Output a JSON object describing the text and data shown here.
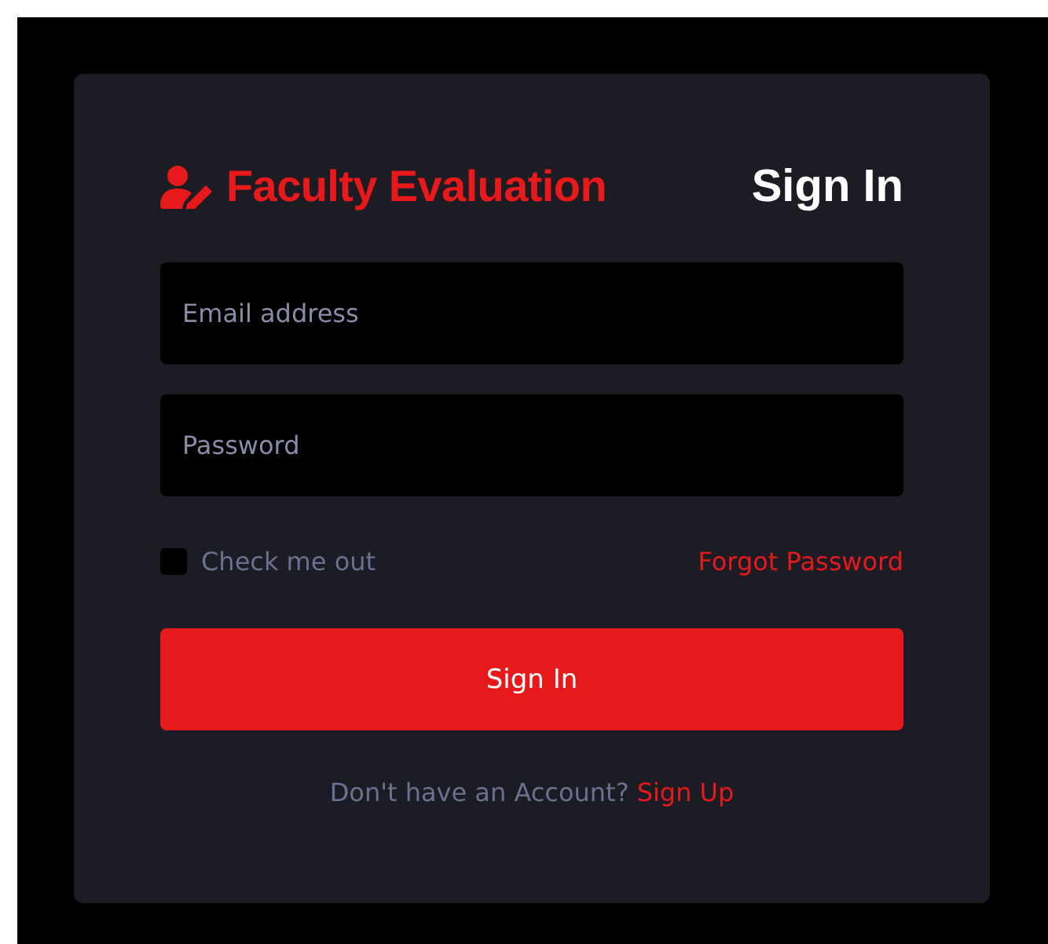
{
  "brand": {
    "title": "Faculty Evaluation"
  },
  "heading": "Sign In",
  "fields": [
    {
      "placeholder": "Email address"
    },
    {
      "placeholder": "Password"
    }
  ],
  "remember": {
    "label": "Check me out",
    "checked": false
  },
  "forgot_link": "Forgot Password",
  "submit": "Sign In",
  "footer": {
    "text": "Don't have an Account?",
    "link": "Sign Up"
  }
}
